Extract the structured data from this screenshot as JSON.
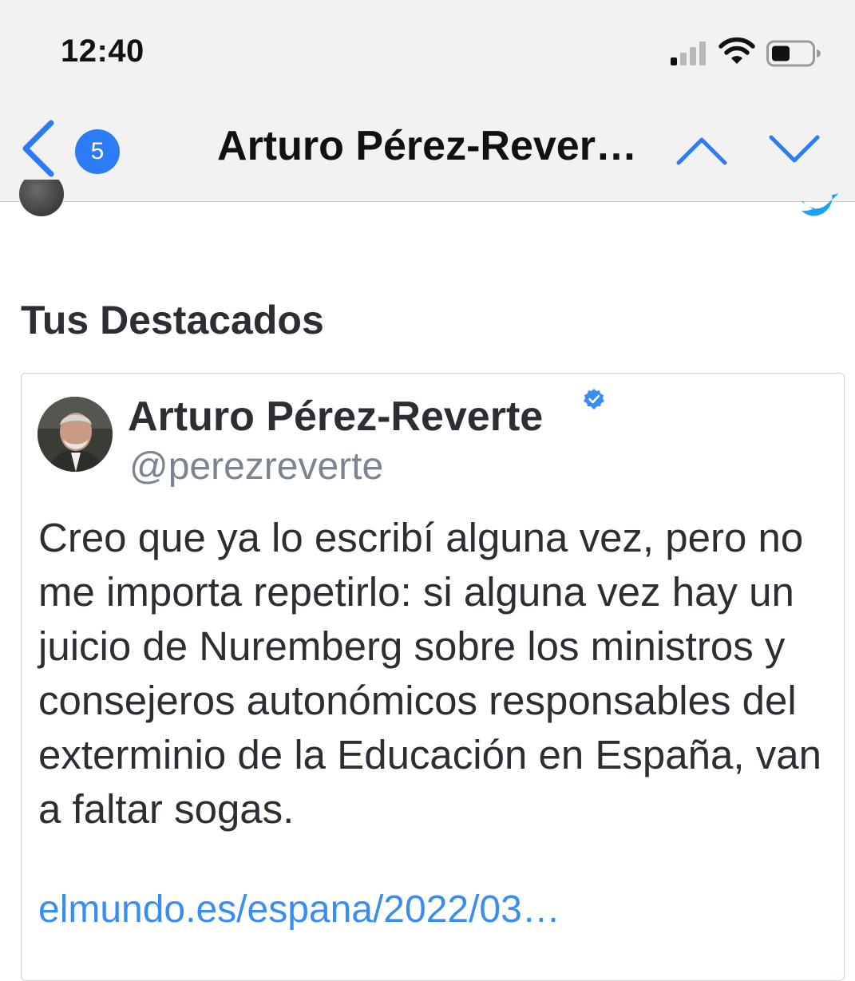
{
  "status_bar": {
    "time": "12:40",
    "icons": [
      "cellular-signal-icon",
      "wifi-icon",
      "battery-icon"
    ]
  },
  "nav": {
    "back_icon": "chevron-left-icon",
    "badge_count": "5",
    "title": "Arturo Pérez-Rever…",
    "up_icon": "chevron-up-icon",
    "down_icon": "chevron-down-icon"
  },
  "section": {
    "title": "Tus Destacados"
  },
  "tweet": {
    "author_name": "Arturo Pérez-Reverte",
    "verified_icon": "verified-badge-icon",
    "handle": "@perezreverte",
    "text": "Creo que ya lo escribí alguna vez, pero no me importa repetirlo: si alguna vez hay un juicio de Nuremberg sobre los ministros y consejeros autonómicos responsables del exterminio de la Educación en España, van a faltar sogas.",
    "link": "elmundo.es/espana/2022/03…"
  },
  "colors": {
    "accent_blue": "#2d7cf6",
    "link_blue": "#3a8df0",
    "twitter_blue": "#1da1f2",
    "text_dark": "#2b2e33",
    "handle_gray": "#7a8591",
    "bar_bg": "#f2f2f3"
  }
}
